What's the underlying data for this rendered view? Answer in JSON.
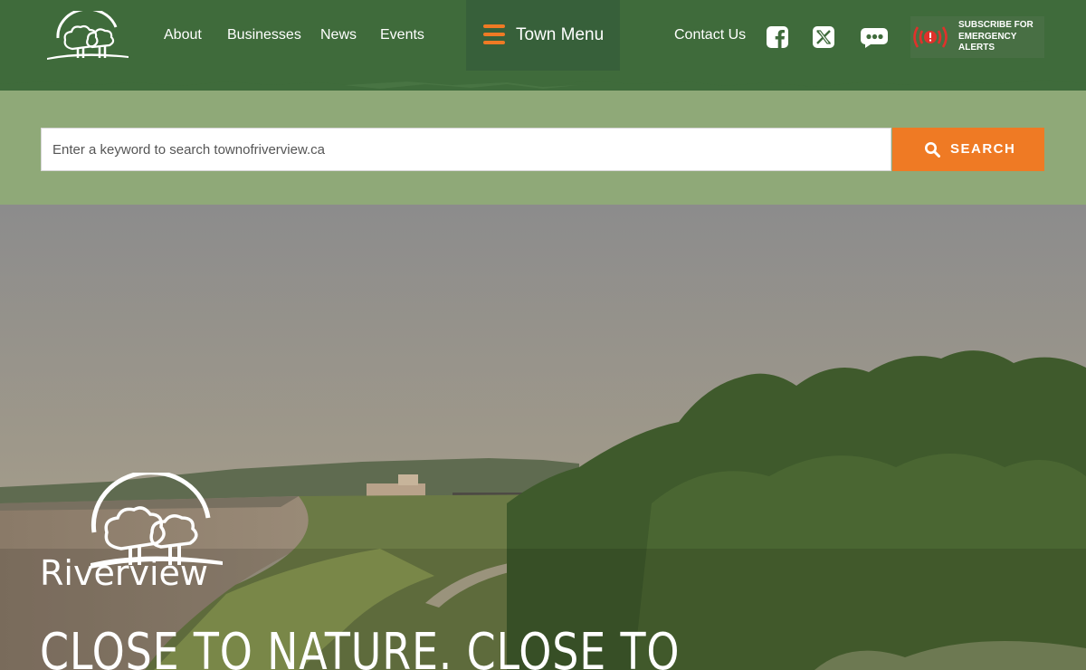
{
  "header": {
    "nav": [
      {
        "label": "About"
      },
      {
        "label": "Businesses"
      },
      {
        "label": "News"
      },
      {
        "label": "Events"
      }
    ],
    "town_menu_label": "Town Menu",
    "contact_label": "Contact Us",
    "social": [
      {
        "icon": "facebook-icon"
      },
      {
        "icon": "x-icon"
      },
      {
        "icon": "more-icon"
      }
    ],
    "alert_label": "Subscribe for Emergency Alerts",
    "colors": {
      "header": "#3f6b3b",
      "accent": "#ef7a24",
      "alert_red": "#e0312b"
    }
  },
  "search": {
    "placeholder": "Enter a keyword to search townofriverview.ca",
    "button_label": "Search"
  },
  "hero": {
    "logo_text": "Riverview",
    "headline": "CLOSE TO NATURE. CLOSE TO"
  }
}
